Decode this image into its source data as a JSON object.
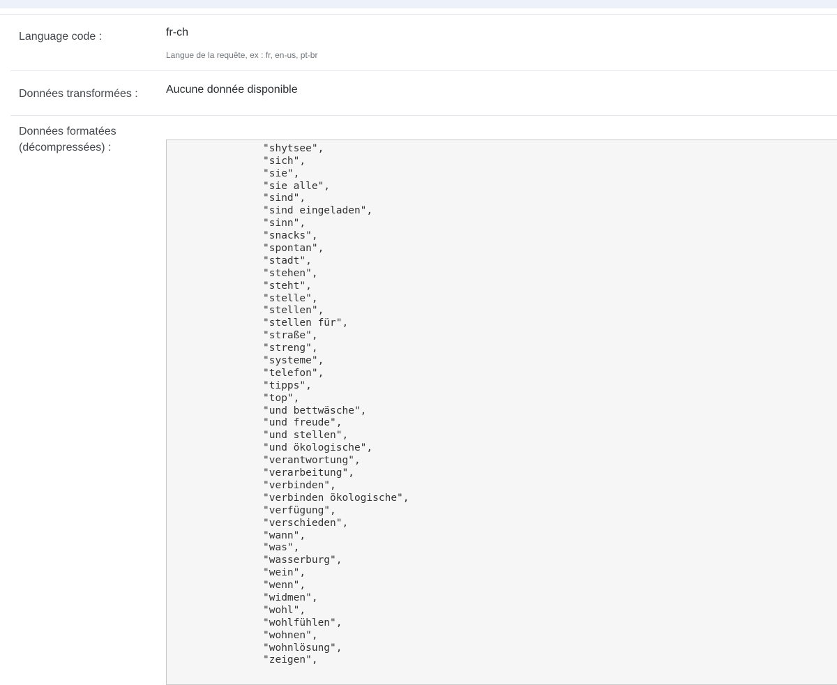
{
  "language_code": {
    "label": "Language code :",
    "value": "fr-ch",
    "help": "Langue de la requête, ex : fr, en-us, pt-br"
  },
  "transformed": {
    "label": "Données transformées :",
    "value": "Aucune donnée disponible"
  },
  "formatted": {
    "label_line1": "Données formatées",
    "label_line2": "(décompressées) :",
    "lines": [
      "\",",
      "\"shytsee\",",
      "\"sich\",",
      "\"sie\",",
      "\"sie alle\",",
      "\"sind\",",
      "\"sind eingeladen\",",
      "\"sinn\",",
      "\"snacks\",",
      "\"spontan\",",
      "\"stadt\",",
      "\"stehen\",",
      "\"steht\",",
      "\"stelle\",",
      "\"stellen\",",
      "\"stellen für\",",
      "\"straße\",",
      "\"streng\",",
      "\"systeme\",",
      "\"telefon\",",
      "\"tipps\",",
      "\"top\",",
      "\"und bettwäsche\",",
      "\"und freude\",",
      "\"und stellen\",",
      "\"und ökologische\",",
      "\"verantwortung\",",
      "\"verarbeitung\",",
      "\"verbinden\",",
      "\"verbinden ökologische\",",
      "\"verfügung\",",
      "\"verschieden\",",
      "\"wann\",",
      "\"was\",",
      "\"wasserburg\",",
      "\"wein\",",
      "\"wenn\",",
      "\"widmen\",",
      "\"wohl\",",
      "\"wohlfühlen\",",
      "\"wohnen\",",
      "\"wohnlösung\",",
      "\"zeigen\","
    ]
  }
}
